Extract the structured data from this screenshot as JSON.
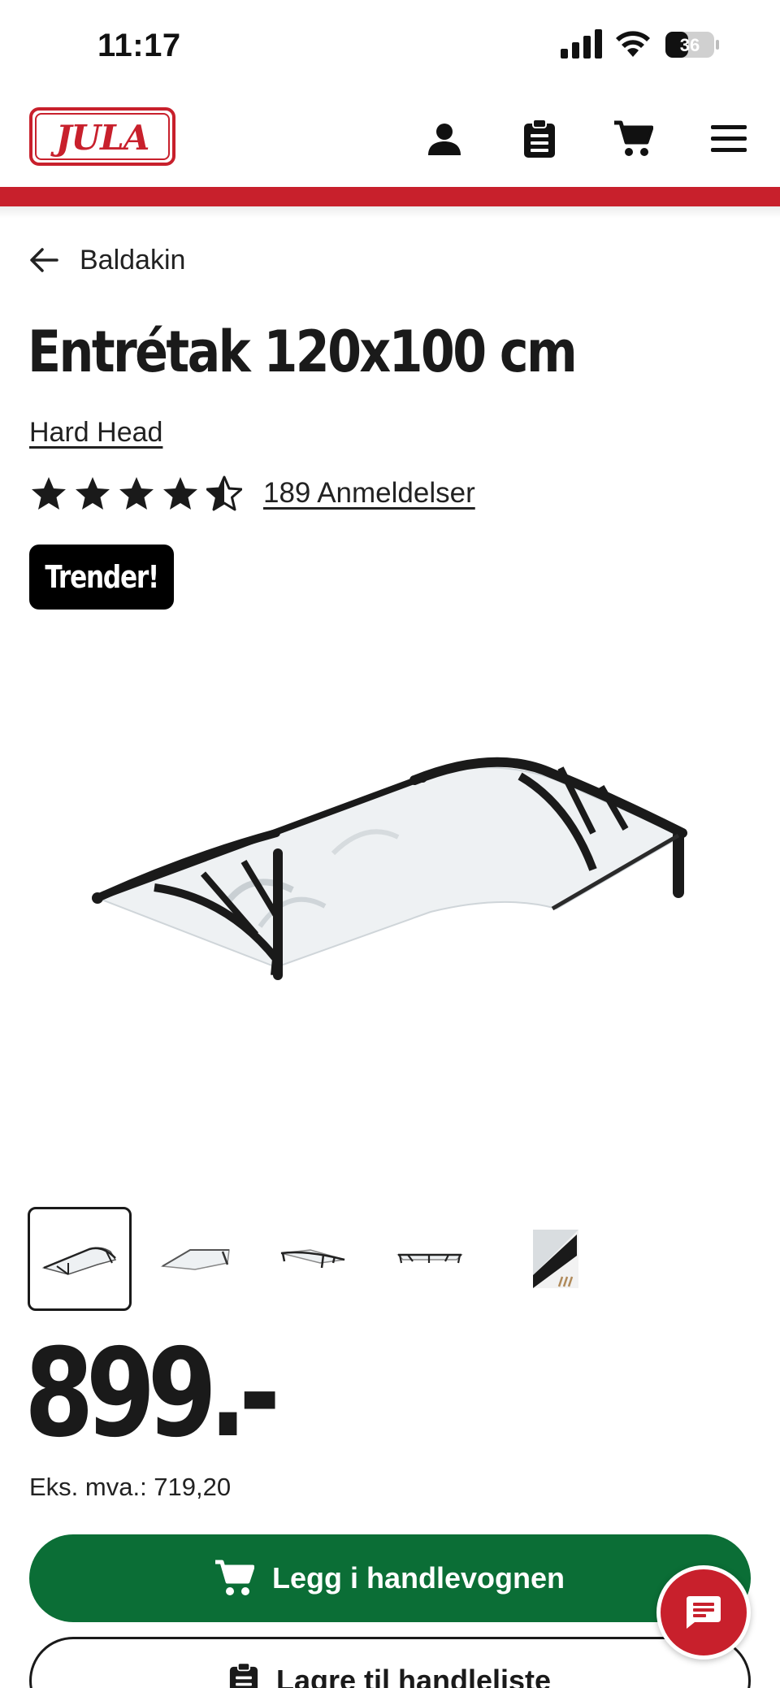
{
  "status_bar": {
    "time": "11:17",
    "battery": "36"
  },
  "header": {
    "logo_text": "JULA",
    "brand_color": "#c8202c",
    "icons": [
      "user-icon",
      "shopping-list-icon",
      "cart-icon",
      "menu-icon"
    ]
  },
  "breadcrumb": {
    "label": "Baldakin"
  },
  "product": {
    "title": "Entrétak 120x100 cm",
    "brand": "Hard Head",
    "rating": 4.5,
    "reviews_label": "189 Anmeldelser",
    "badge": "Trender!",
    "thumbnail_count": 5,
    "active_thumbnail": 1
  },
  "pricing": {
    "price": "899.-",
    "ex_vat": "Eks. mva.: 719,20"
  },
  "actions": {
    "add_to_cart": "Legg i handlevognen",
    "save_to_list": "Lagre til handleliste",
    "cart_button_color": "#0b6e36"
  }
}
